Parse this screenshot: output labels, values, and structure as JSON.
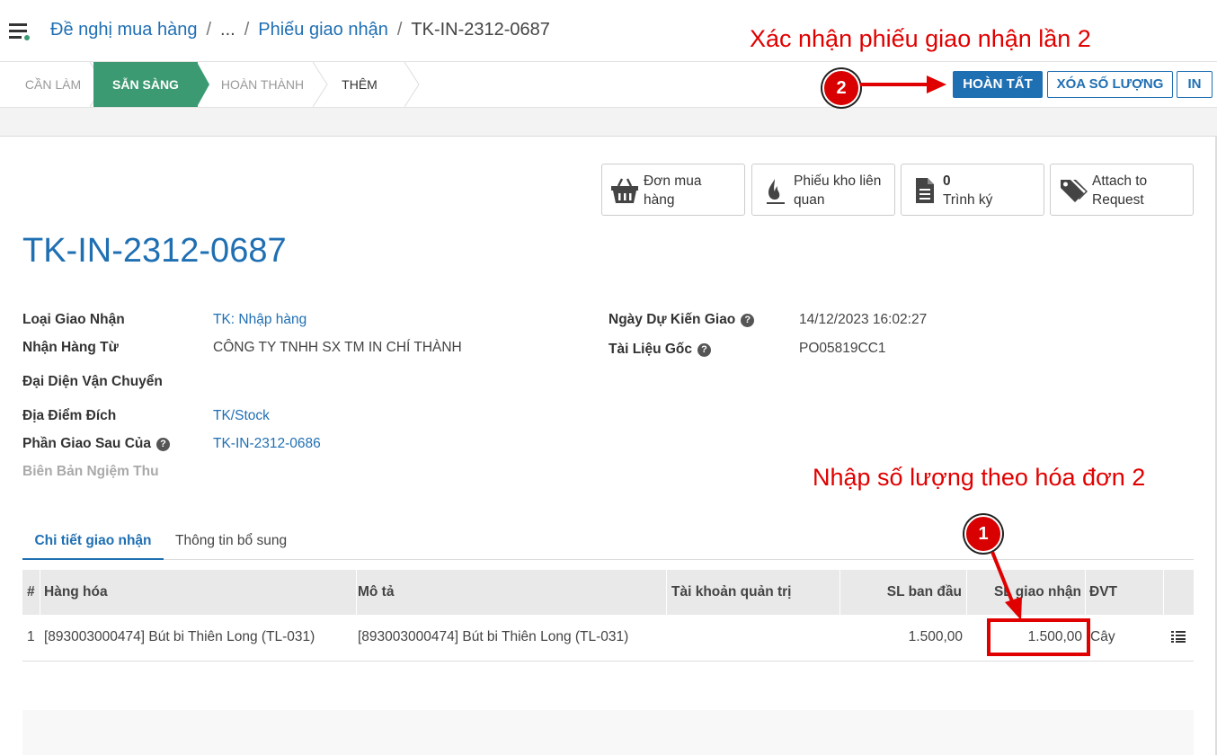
{
  "breadcrumb": {
    "items": [
      "Đề nghị mua hàng",
      "...",
      "Phiếu giao nhận"
    ],
    "current": "TK-IN-2312-0687",
    "separator": "/"
  },
  "status_bar": {
    "stages": [
      "CẦN LÀM",
      "SẴN SÀNG",
      "HOÀN THÀNH",
      "THÊM"
    ],
    "active_stage": "SẴN SÀNG",
    "buttons": {
      "complete": "HOÀN TẤT",
      "clear_qty": "XÓA SỐ LƯỢNG",
      "print": "IN"
    }
  },
  "smart_buttons": {
    "purchase_order": "Đơn mua\nhàng",
    "related_stock": "Phiếu kho liên\nquan",
    "approvals_count": "0",
    "approvals_label": "Trình ký",
    "attach": "Attach to\nRequest"
  },
  "record": {
    "title": "TK-IN-2312-0687",
    "fields": {
      "operation_type_label": "Loại Giao Nhận",
      "operation_type": "TK: Nhập hàng",
      "partner_label": "Nhận Hàng Từ",
      "partner": "CÔNG TY TNHH SX TM IN CHÍ THÀNH",
      "carrier_label": "Đại Diện Vận Chuyển",
      "dest_label": "Địa Điểm Đích",
      "dest": "TK/Stock",
      "backorder_label": "Phần Giao Sau Của",
      "backorder": "TK-IN-2312-0686",
      "acceptance_label": "Biên Bản Ngiệm Thu",
      "scheduled_label": "Ngày Dự Kiến Giao",
      "scheduled": "14/12/2023 16:02:27",
      "origin_label": "Tài Liệu Gốc",
      "origin": "PO05819CC1"
    }
  },
  "tabs": [
    "Chi tiết giao nhận",
    "Thông tin bổ sung"
  ],
  "table": {
    "headers": [
      "#",
      "Hàng hóa",
      "Mô tả",
      "Tài khoản quản trị",
      "SL ban đầu",
      "SL giao nhận",
      "ĐVT"
    ],
    "rows": [
      {
        "index": "1",
        "product": "[893003000474] Bút bi Thiên Long (TL-031)",
        "description": "[893003000474] Bút bi Thiên Long (TL-031)",
        "analytic": "",
        "initial_qty": "1.500,00",
        "done_qty": "1.500,00",
        "uom": "Cây"
      }
    ]
  },
  "annotations": {
    "note_confirm": "Xác nhận phiếu giao nhận lần 2",
    "note_enter_qty": "Nhập số lượng theo hóa đơn 2",
    "badge_1": "1",
    "badge_2": "2"
  },
  "colors": {
    "accent": "#1f6fb3",
    "active_stage": "#3c9a73",
    "annotation": "#e00000"
  },
  "help_glyph": "?"
}
